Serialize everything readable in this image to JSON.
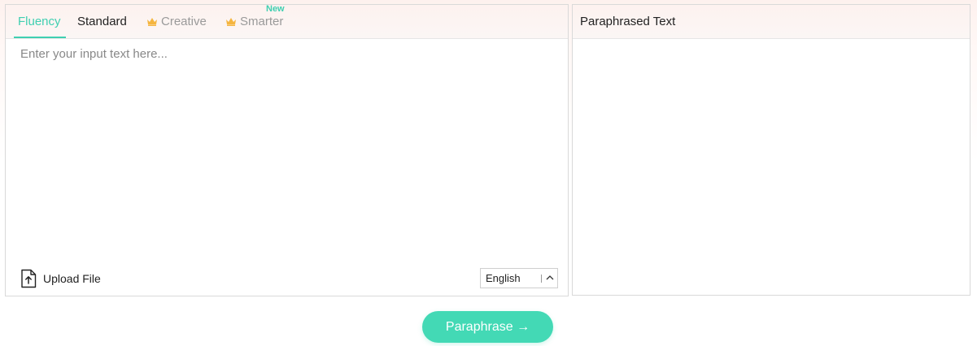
{
  "tabs": [
    {
      "label": "Fluency",
      "state": "active",
      "crown": false
    },
    {
      "label": "Standard",
      "state": "normal",
      "crown": false
    },
    {
      "label": "Creative",
      "state": "premium",
      "crown": true
    },
    {
      "label": "Smarter",
      "state": "premium",
      "crown": true,
      "badge": "New"
    }
  ],
  "input": {
    "placeholder": "Enter your input text here...",
    "value": ""
  },
  "upload": {
    "label": "Upload File",
    "icon": "upload-file-icon"
  },
  "language": {
    "selected": "English"
  },
  "output": {
    "title": "Paraphrased Text",
    "value": ""
  },
  "action": {
    "label": "Paraphrase →"
  },
  "colors": {
    "accent": "#3fcfb1",
    "button": "#43d9b5",
    "crown": "#f5b53f"
  }
}
